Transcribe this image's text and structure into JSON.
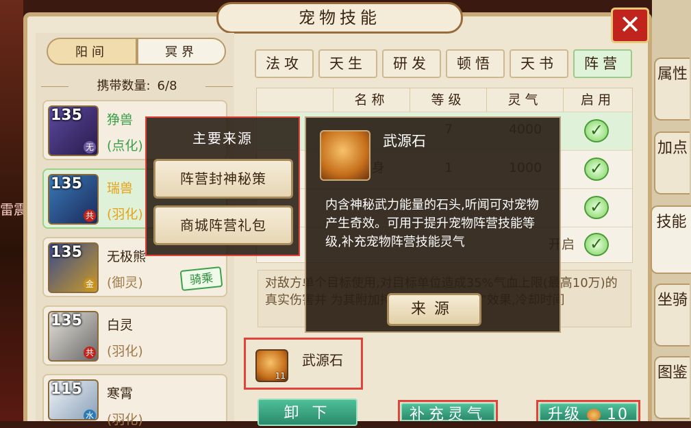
{
  "title": "宠物技能",
  "close_glyph": "✕",
  "realm_tabs": [
    "阳间",
    "冥界"
  ],
  "carry": {
    "label": "携带数量:",
    "value": "6/8"
  },
  "pets": [
    {
      "level": "135",
      "name": "狰兽",
      "type": "(点化)",
      "badge": "无",
      "badge_color": "#6a5aa0",
      "name_color": "#3aa04a",
      "type_color": "#3aa04a"
    },
    {
      "level": "135",
      "name": "瑞兽",
      "type": "(羽化)",
      "badge": "共",
      "badge_color": "#c0241c",
      "name_color": "#e6a21a",
      "type_color": "#e6a21a"
    },
    {
      "level": "135",
      "name": "无极熊",
      "type": "(御灵)",
      "badge": "金",
      "badge_color": "#c8901c",
      "name_color": "#3a2412",
      "type_color": "#a07a4a",
      "ride": "骑乘"
    },
    {
      "level": "135",
      "name": "白灵",
      "type": "(羽化)",
      "badge": "共",
      "badge_color": "#c0241c",
      "name_color": "#3a2412",
      "type_color": "#a07a4a"
    },
    {
      "level": "115",
      "name": "寒霄",
      "type": "(羽化)",
      "badge": "水",
      "badge_color": "#2a7ab8",
      "name_color": "#3a2412",
      "type_color": "#a07a4a"
    }
  ],
  "skill_tabs": [
    "法攻",
    "天生",
    "研发",
    "顿悟",
    "天书",
    "阵营"
  ],
  "skill_table": {
    "headers": [
      "名称",
      "等级",
      "灵气",
      "启用"
    ],
    "rows": [
      {
        "name": "",
        "level": "7",
        "qi": "4000"
      },
      {
        "name": "彼身",
        "level": "1",
        "qi": "1000"
      },
      {
        "name": "",
        "level": "",
        "qi": ""
      },
      {
        "name": "",
        "level": "",
        "qi": "开启"
      }
    ]
  },
  "description": "对敌方单个目标使用,对目标单位造成35%气血上限(最高10万)的真实伤害并 为其附加持续2回合的“失魂”效果,冷却时间",
  "material": {
    "name": "武源石",
    "count": "11"
  },
  "buttons": {
    "unload": "卸 下",
    "replenish": "补充灵气",
    "upgrade": "升级",
    "upgrade_cost": "10"
  },
  "side_tabs": [
    "属性",
    "加点",
    "技能",
    "坐骑",
    "图鉴"
  ],
  "source_popup": {
    "title": "主要来源",
    "options": [
      "阵营封神秘策",
      "商城阵营礼包"
    ]
  },
  "item_popup": {
    "name": "武源石",
    "desc": "内含神秘武力能量的石头,听闻可对宠物产生奇效。可用于提升宠物阵营技能等级,补充宠物阵营技能灵气",
    "button": "来源"
  },
  "bg_text": "雷震"
}
